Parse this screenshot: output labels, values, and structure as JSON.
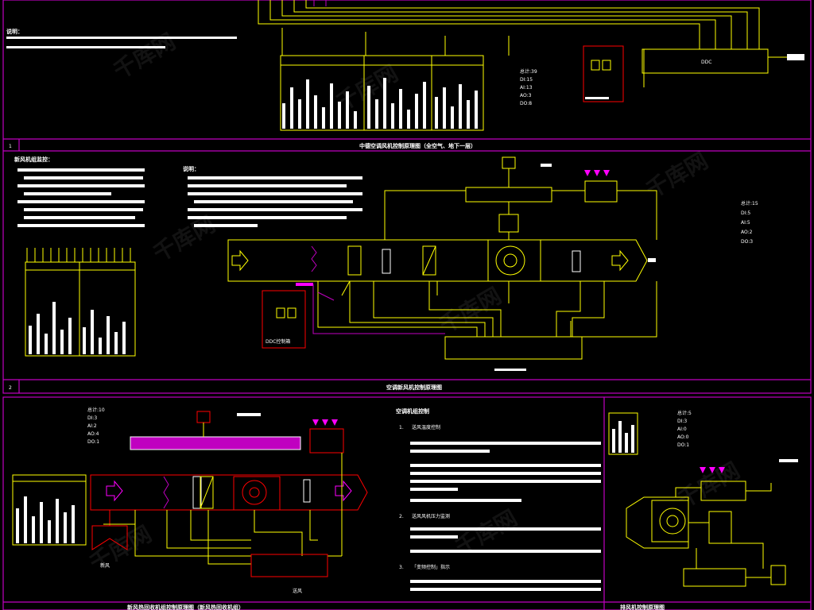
{
  "colors": {
    "frame": "#c000c0",
    "line": "#ffff00",
    "fan": "#ff2020",
    "text": "#ffffff",
    "panel": "#ff0000",
    "label_bar": "#ff00ff",
    "duct_top": "#c000c0",
    "background": "#000000"
  },
  "section1": {
    "number": "1",
    "title": "中德空调风机控制原理图（全空气、地下一层）",
    "note_heading": "说明：",
    "stats": {
      "total": "总计:39",
      "di": "DI:15",
      "ai": "AI:13",
      "ao": "AO:3",
      "do": "DO:8"
    },
    "ddc_label": "DDC",
    "panel_label": "DDC"
  },
  "section2": {
    "number": "2",
    "title": "空调新风机控制原理图",
    "note_heading": "新风机组监控：",
    "notes_title": "说明：",
    "stats": {
      "total": "总计:15",
      "di": "DI:5",
      "ai": "AI:5",
      "ao": "AO:2",
      "do": "DO:3"
    },
    "panel_label": "DDC控制箱",
    "inlet_label": "新风",
    "supply_label": "送风"
  },
  "section3": {
    "title": "新风热回收机组控制原理图（新风热回收机组）",
    "stats": {
      "total": "总计:10",
      "di": "DI:3",
      "ai": "AI:2",
      "ao": "AO:4",
      "do": "DO:1"
    },
    "notes_heading": "空调机组控制",
    "notes": [
      {
        "num": "1.",
        "title": "送风温度控制"
      },
      {
        "num": "2.",
        "title": "送风风机压力监测"
      },
      {
        "num": "3.",
        "title": "「变频控制」指示"
      }
    ],
    "inlet_label": "新风",
    "supply_label": "送风"
  },
  "section4": {
    "stats": {
      "total": "总计:5",
      "di": "DI:3",
      "ai": "AI:0",
      "ao": "AO:0",
      "do": "DO:1"
    },
    "title": "排风机控制原理图"
  },
  "watermark": "千库网"
}
